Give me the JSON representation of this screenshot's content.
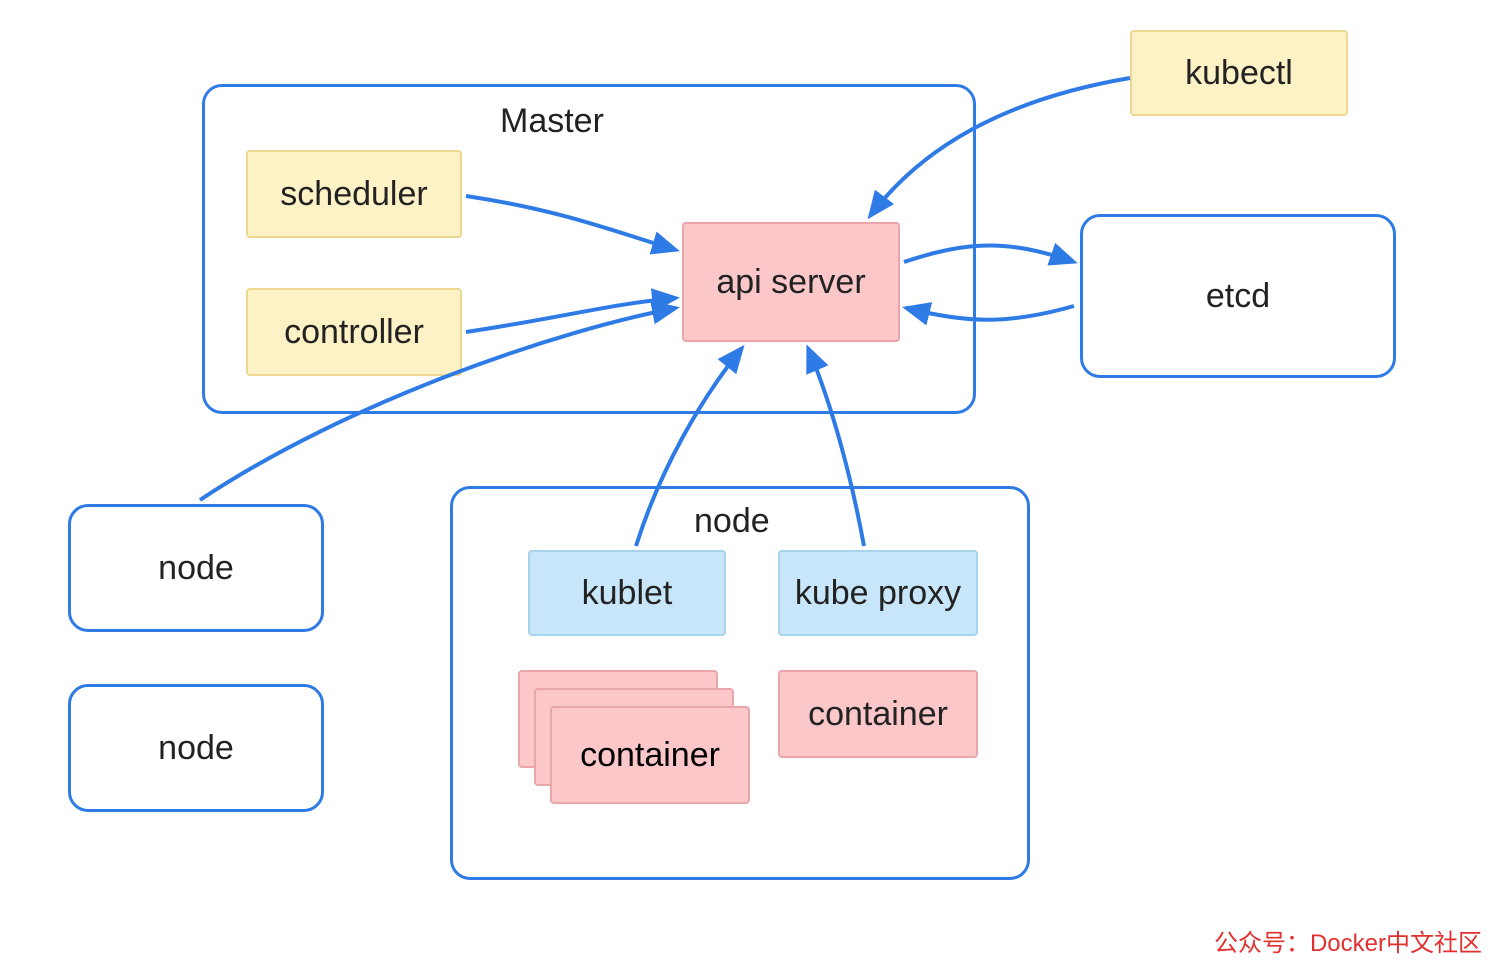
{
  "master": {
    "title": "Master",
    "scheduler": "scheduler",
    "controller": "controller",
    "api_server": "api server"
  },
  "kubectl": "kubectl",
  "etcd": "etcd",
  "node_left_1": "node",
  "node_left_2": "node",
  "node_main": {
    "title": "node",
    "kublet": "kublet",
    "kube_proxy": "kube proxy",
    "container_stack": "container",
    "container_single": "container"
  },
  "watermark": "公众号：Docker中文社区"
}
